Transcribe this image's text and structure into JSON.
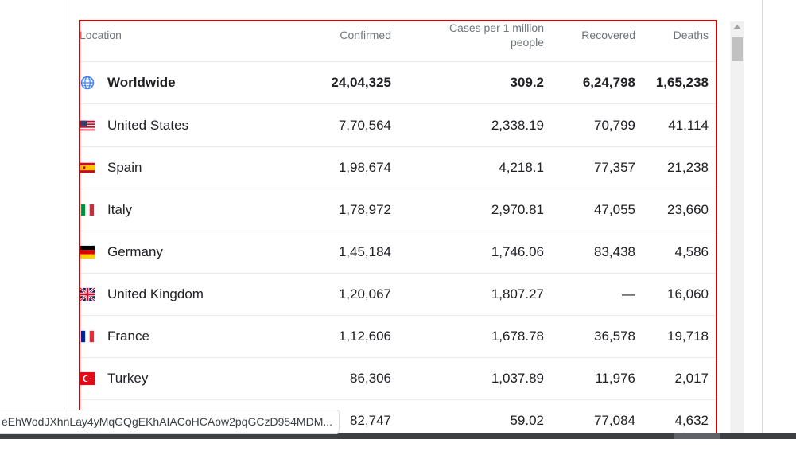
{
  "table": {
    "headers": {
      "location": "Location",
      "confirmed": "Confirmed",
      "cases_per_million": "Cases per 1 million people",
      "recovered": "Recovered",
      "deaths": "Deaths"
    },
    "rows": [
      {
        "location": "Worldwide",
        "icon": "globe-icon",
        "confirmed": "24,04,325",
        "cases_per_million": "309.2",
        "recovered": "6,24,798",
        "deaths": "1,65,238"
      },
      {
        "location": "United States",
        "icon": "us-flag-icon",
        "confirmed": "7,70,564",
        "cases_per_million": "2,338.19",
        "recovered": "70,799",
        "deaths": "41,114"
      },
      {
        "location": "Spain",
        "icon": "spain-flag-icon",
        "confirmed": "1,98,674",
        "cases_per_million": "4,218.1",
        "recovered": "77,357",
        "deaths": "21,238"
      },
      {
        "location": "Italy",
        "icon": "italy-flag-icon",
        "confirmed": "1,78,972",
        "cases_per_million": "2,970.81",
        "recovered": "47,055",
        "deaths": "23,660"
      },
      {
        "location": "Germany",
        "icon": "germany-flag-icon",
        "confirmed": "1,45,184",
        "cases_per_million": "1,746.06",
        "recovered": "83,438",
        "deaths": "4,586"
      },
      {
        "location": "United Kingdom",
        "icon": "uk-flag-icon",
        "confirmed": "1,20,067",
        "cases_per_million": "1,807.27",
        "recovered": "—",
        "deaths": "16,060"
      },
      {
        "location": "France",
        "icon": "france-flag-icon",
        "confirmed": "1,12,606",
        "cases_per_million": "1,678.78",
        "recovered": "36,578",
        "deaths": "19,718"
      },
      {
        "location": "Turkey",
        "icon": "turkey-flag-icon",
        "confirmed": "86,306",
        "cases_per_million": "1,037.89",
        "recovered": "11,976",
        "deaths": "2,017"
      },
      {
        "location": "",
        "icon": "",
        "confirmed": "82,747",
        "cases_per_million": "59.02",
        "recovered": "77,084",
        "deaths": "4,632"
      }
    ]
  },
  "status_bar": {
    "url": "eEhWodJXhnLay4yMqGQgEKhAIACoHCAow2pqGCzD954MDM..."
  },
  "colors": {
    "highlight_border": "#d50000",
    "header_text": "#70757a",
    "row_divider": "#e8eaed"
  }
}
